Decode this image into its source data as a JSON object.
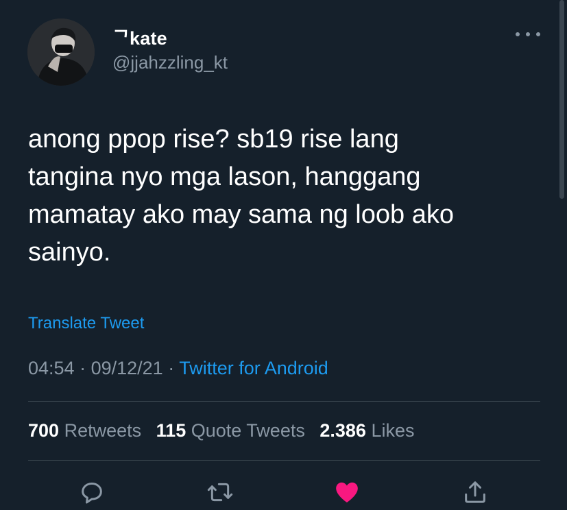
{
  "user": {
    "display_name": "ᄀkate",
    "handle": "@jjahzzling_kt"
  },
  "tweet": {
    "text_lines": [
      "anong ppop rise? sb19 rise lang",
      "tangina nyo mga lason, hanggang",
      "mamatay ako may sama ng loob ako",
      "sainyo."
    ],
    "translate_label": "Translate Tweet",
    "time": "04:54",
    "separator": " · ",
    "date": "09/12/21",
    "source": "Twitter for Android"
  },
  "stats": {
    "retweets_count": "700",
    "retweets_label": "Retweets",
    "quote_count": "115",
    "quote_label": "Quote Tweets",
    "likes_count": "2.386",
    "likes_label": "Likes"
  },
  "actions": {
    "reply_icon": "reply-icon",
    "retweet_icon": "retweet-icon",
    "like_icon": "heart-icon",
    "share_icon": "share-icon"
  },
  "colors": {
    "background": "#15202b",
    "secondary_text": "#8b98a5",
    "link": "#1d9bf0",
    "like": "#f91880"
  }
}
